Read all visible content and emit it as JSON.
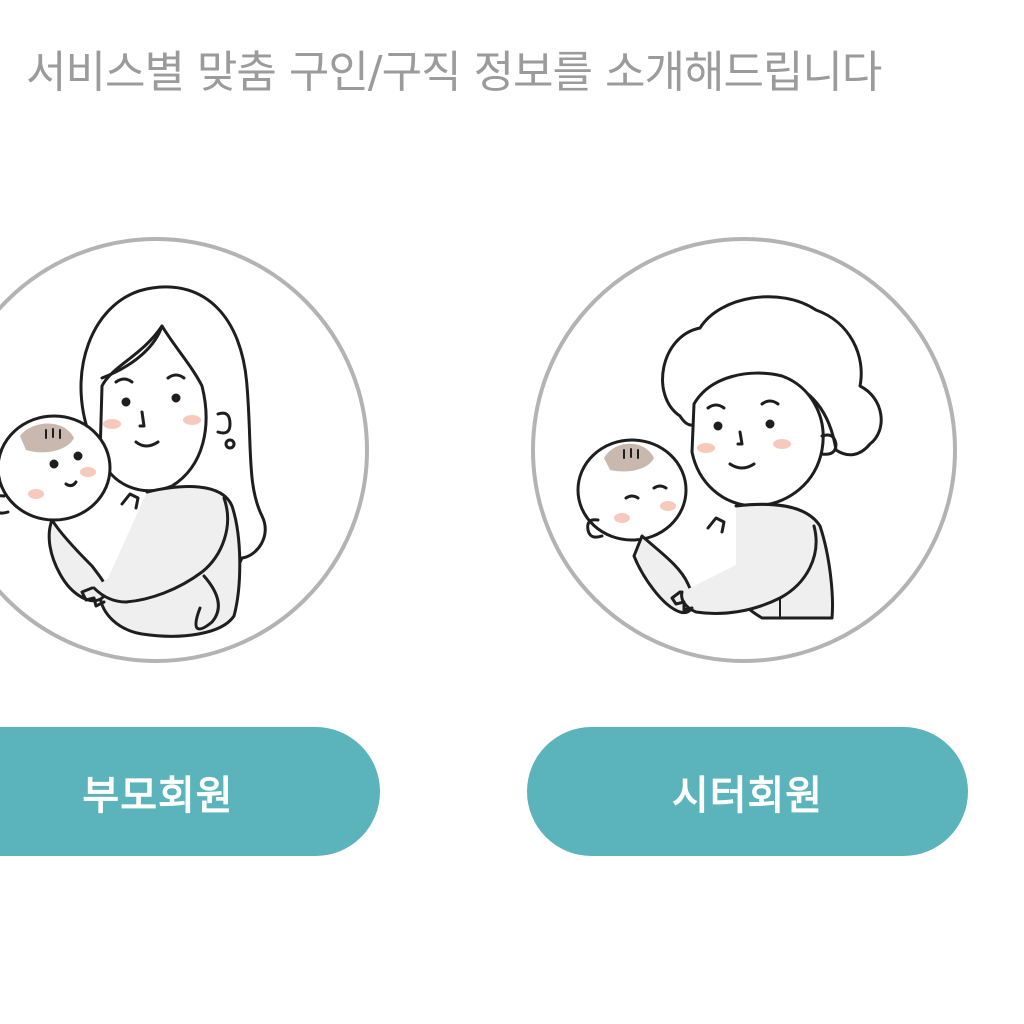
{
  "header": {
    "headline": "서비스별 맞춤 구인/구직 정보를 소개해드립니다"
  },
  "members": [
    {
      "id": "parent",
      "label": "부모회원",
      "illustration": "mother-holding-baby"
    },
    {
      "id": "sitter",
      "label": "시터회원",
      "illustration": "grandmother-holding-baby"
    }
  ],
  "colors": {
    "accent": "#5bb3bb",
    "headline_text": "#9b9b9b",
    "button_text": "#ffffff",
    "portrait_ring": "#b3b3b3",
    "line_art": "#1e1e1e",
    "clothing_fill": "#efefef",
    "baby_hair": "#c9b8ad",
    "cheek_blush": "#f6c9bd"
  }
}
